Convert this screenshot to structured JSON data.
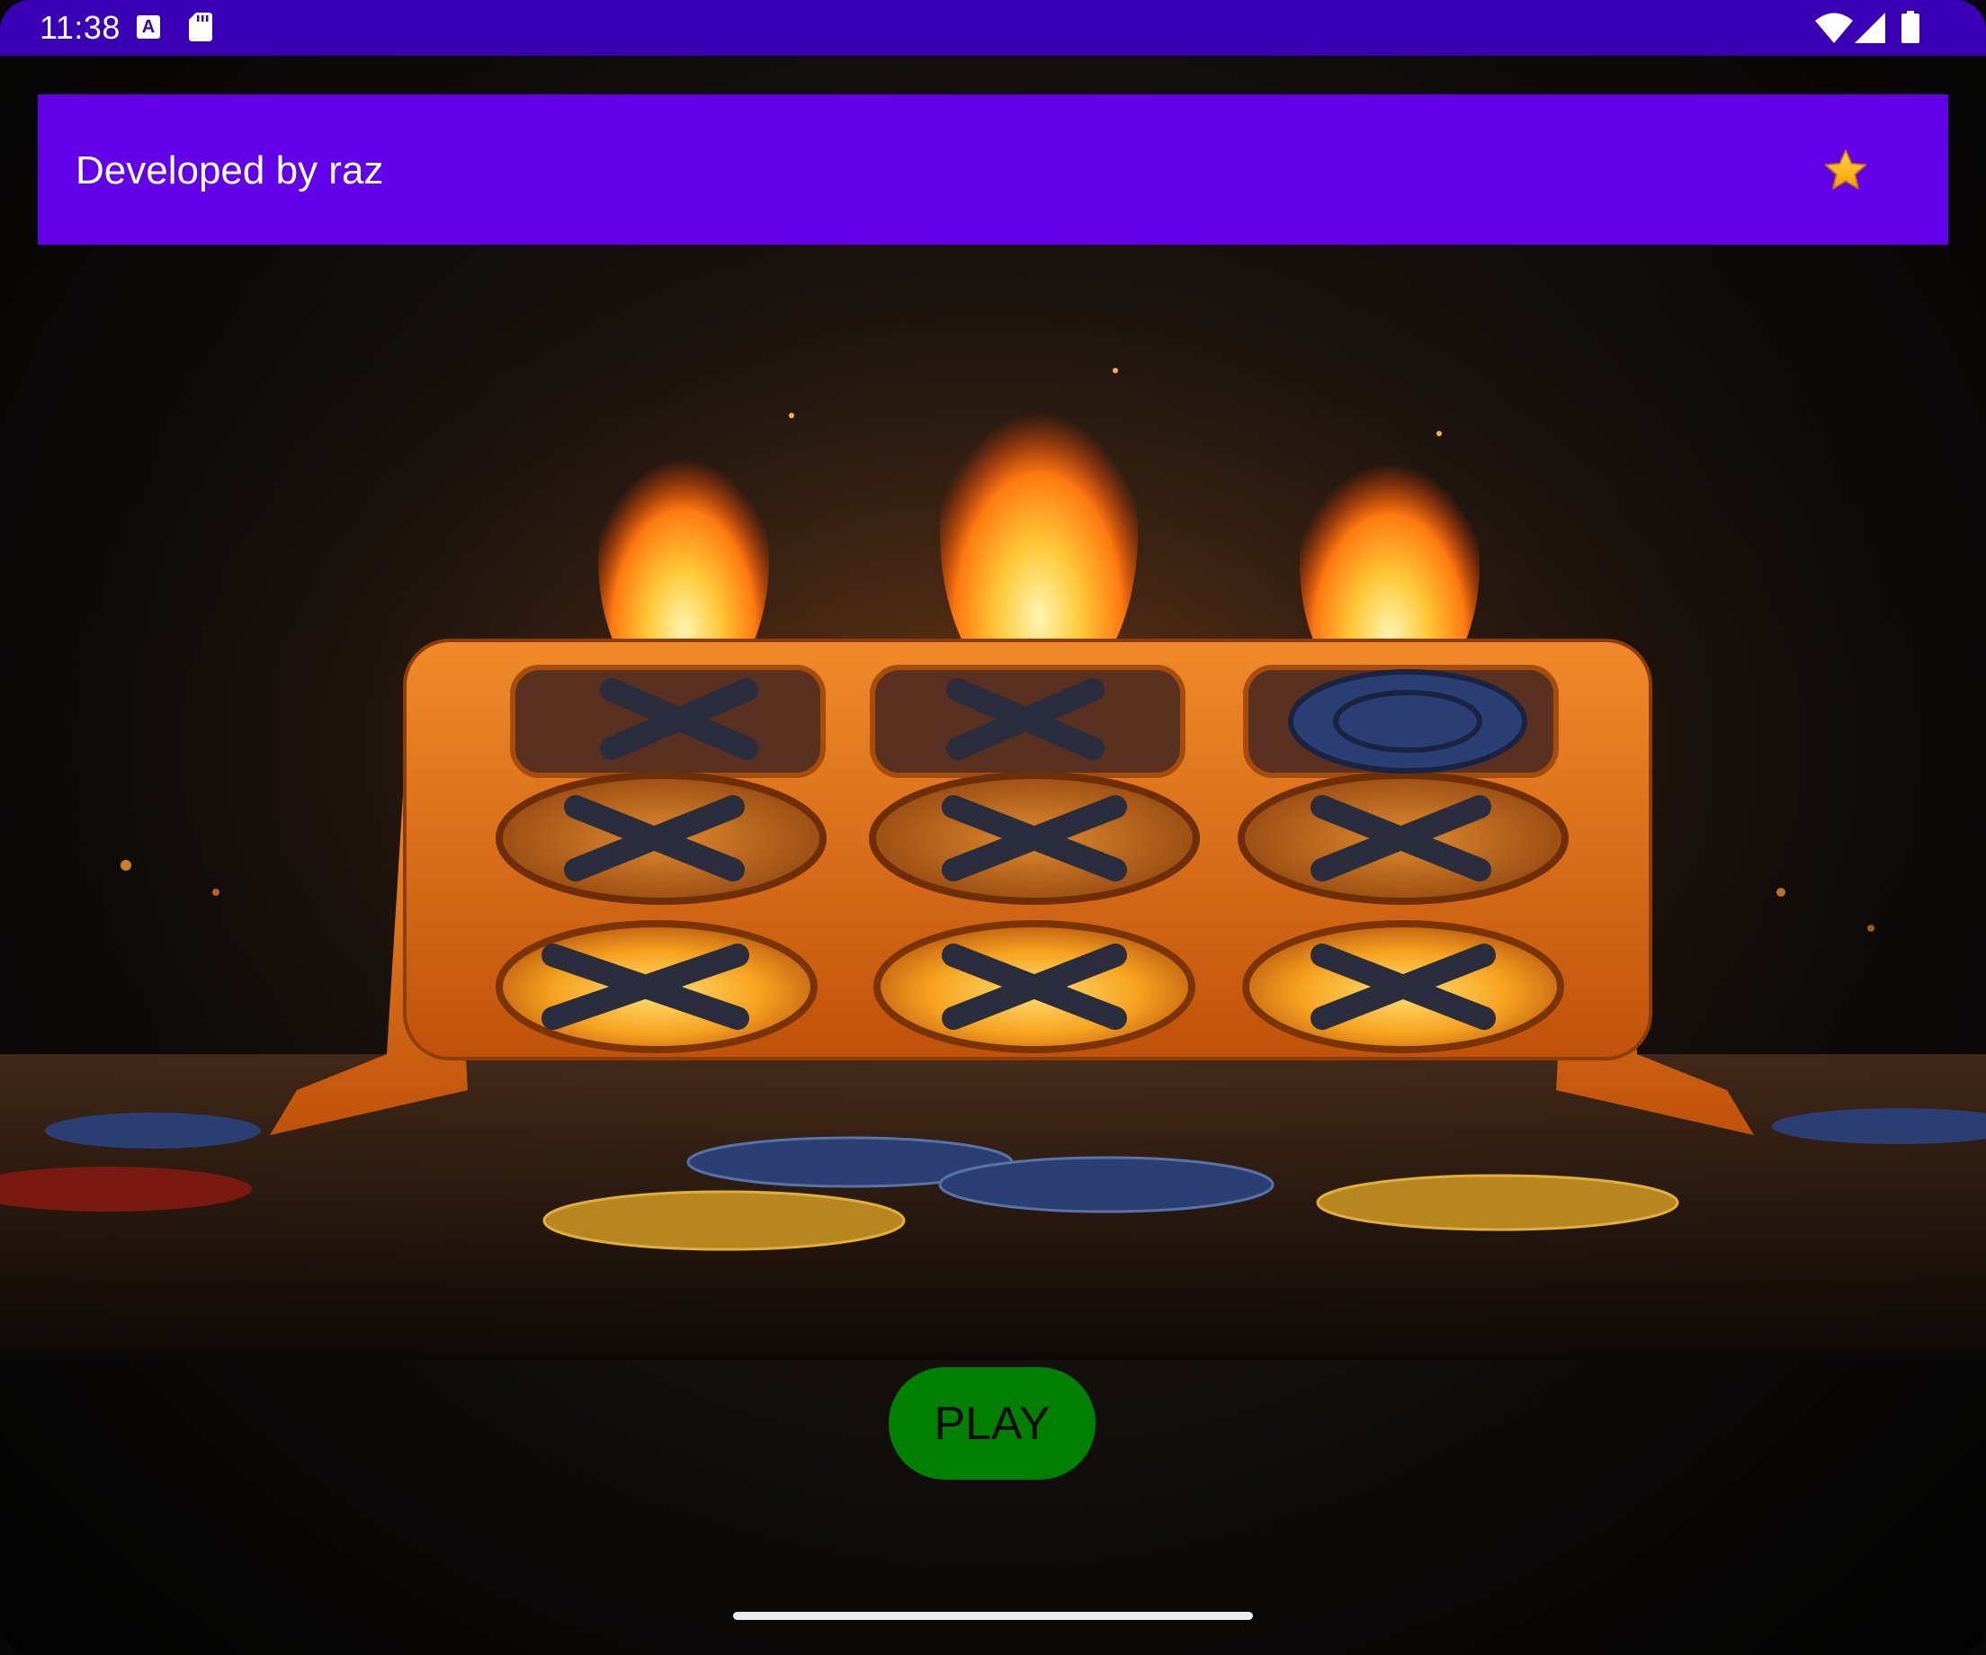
{
  "status_bar": {
    "time": "11:38",
    "a_icon_letter": "A",
    "icons": [
      "a-icon",
      "sd-card-icon",
      "wifi-icon",
      "signal-icon",
      "battery-icon"
    ]
  },
  "app_bar": {
    "title": "Developed by raz",
    "action_icon": "star-icon",
    "background_color": "#6200ea"
  },
  "hero_image": {
    "board": [
      [
        "X",
        "X",
        "O"
      ],
      [
        "X",
        "X",
        "X"
      ],
      [
        "X",
        "X",
        "X"
      ]
    ]
  },
  "play_button": {
    "label": "PLAY",
    "color": "#008000"
  },
  "colors": {
    "status_bar": "#3a00b6",
    "accent": "#6200ea"
  }
}
